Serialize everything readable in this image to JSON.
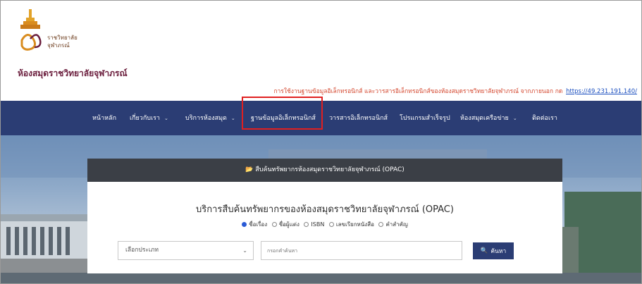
{
  "logo": {
    "line1": "ราชวิทยาลัย",
    "line2": "จุฬาภรณ์"
  },
  "site_title": "ห้องสมุดราชวิทยาลัยจุฬาภรณ์",
  "notice": {
    "text": "การใช้งานฐานข้อมูลอิเล็กทรอนิกส์ และวารสารอิเล็กทรอนิกส์ของห้องสมุดราชวิทยาลัยจุฬาภรณ์ จากภายนอก กด",
    "link": "https://49.231.191.140/"
  },
  "nav": {
    "items": [
      {
        "label": "หน้าหลัก",
        "dropdown": false
      },
      {
        "label": "เกี่ยวกับเรา",
        "dropdown": true
      },
      {
        "label": "บริการห้องสมุด",
        "dropdown": true
      },
      {
        "label": "ฐานข้อมูลอิเล็กทรอนิกส์",
        "dropdown": false
      },
      {
        "label": "วารสารอิเล็กทรอนิกส์",
        "dropdown": false
      },
      {
        "label": "โปรแกรมสำเร็จรูป",
        "dropdown": false
      },
      {
        "label": "ห้องสมุดเครือข่าย",
        "dropdown": true
      },
      {
        "label": "ติดต่อเรา",
        "dropdown": false
      }
    ],
    "highlighted_index": 3
  },
  "opac": {
    "header": "สืบค้นทรัพยากรห้องสมุดราชวิทยาลัยจุฬาภรณ์ (OPAC)",
    "title": "บริการสืบค้นทรัพยากรของห้องสมุดราชวิทยาลัยจุฬาภรณ์ (OPAC)",
    "search_options": [
      {
        "label": "ชื่อเรื่อง",
        "selected": true
      },
      {
        "label": "ชื่อผู้แต่ง",
        "selected": false
      },
      {
        "label": "ISBN",
        "selected": false
      },
      {
        "label": "เลขเรียกหนังสือ",
        "selected": false
      },
      {
        "label": "คำสำคัญ",
        "selected": false
      }
    ],
    "type_select": "เลือกประเภท",
    "search_placeholder": "กรอกคำค้นหา",
    "search_button": "ค้นหา"
  },
  "colors": {
    "nav_bg": "#2b3d74",
    "title_color": "#6b1e3d",
    "notice_color": "#d4472e",
    "link_color": "#1b4fbf",
    "highlight": "#e02020",
    "panel_header": "#3b3f46"
  }
}
